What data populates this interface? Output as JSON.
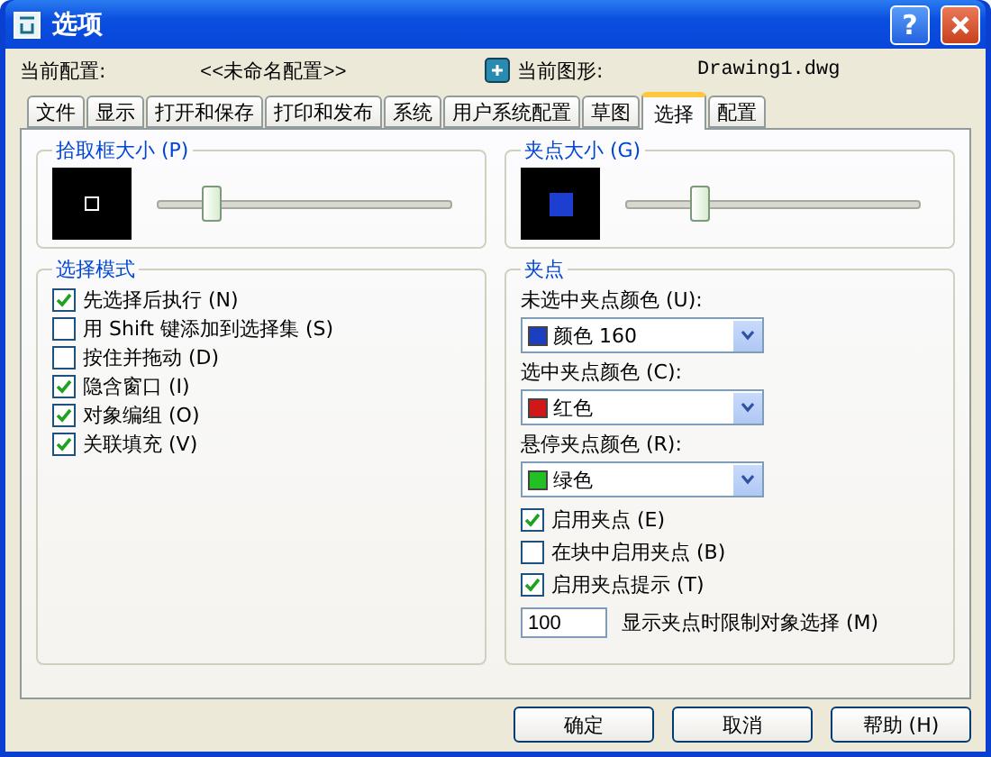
{
  "window": {
    "title": "选项",
    "help": "?"
  },
  "header": {
    "profile_label": "当前配置:",
    "profile_value": "<<未命名配置>>",
    "drawing_label": "当前图形:",
    "drawing_value": "Drawing1.dwg"
  },
  "tabs": [
    {
      "label": "文件",
      "selected": false
    },
    {
      "label": "显示",
      "selected": false
    },
    {
      "label": "打开和保存",
      "selected": false
    },
    {
      "label": "打印和发布",
      "selected": false
    },
    {
      "label": "系统",
      "selected": false
    },
    {
      "label": "用户系统配置",
      "selected": false
    },
    {
      "label": "草图",
      "selected": false
    },
    {
      "label": "选择",
      "selected": true
    },
    {
      "label": "配置",
      "selected": false
    }
  ],
  "pickbox": {
    "title": "拾取框大小 (P)",
    "level": 0.17
  },
  "grip_size": {
    "title": "夹点大小 (G)",
    "level": 0.24
  },
  "selection_modes": {
    "title": "选择模式",
    "options": [
      {
        "label": "先选择后执行 (N)",
        "checked": true
      },
      {
        "label": "用 Shift 键添加到选择集 (S)",
        "checked": false
      },
      {
        "label": "按住并拖动 (D)",
        "checked": false
      },
      {
        "label": "隐含窗口 (I)",
        "checked": true
      },
      {
        "label": "对象编组 (O)",
        "checked": true
      },
      {
        "label": "关联填充 (V)",
        "checked": true
      }
    ]
  },
  "grips": {
    "title": "夹点",
    "colors": [
      {
        "label": "未选中夹点颜色 (U):",
        "value": "颜色 160",
        "color": "#1c3fbf"
      },
      {
        "label": "选中夹点颜色 (C):",
        "value": "红色",
        "color": "#d01818"
      },
      {
        "label": "悬停夹点颜色 (R):",
        "value": "绿色",
        "color": "#22c022"
      }
    ],
    "options": [
      {
        "label": "启用夹点 (E)",
        "checked": true
      },
      {
        "label": "在块中启用夹点 (B)",
        "checked": false
      },
      {
        "label": "启用夹点提示 (T)",
        "checked": true
      }
    ],
    "limit": {
      "value": "100",
      "label": "显示夹点时限制对象选择 (M)"
    }
  },
  "buttons": [
    "确定",
    "取消",
    "帮助 (H)"
  ]
}
